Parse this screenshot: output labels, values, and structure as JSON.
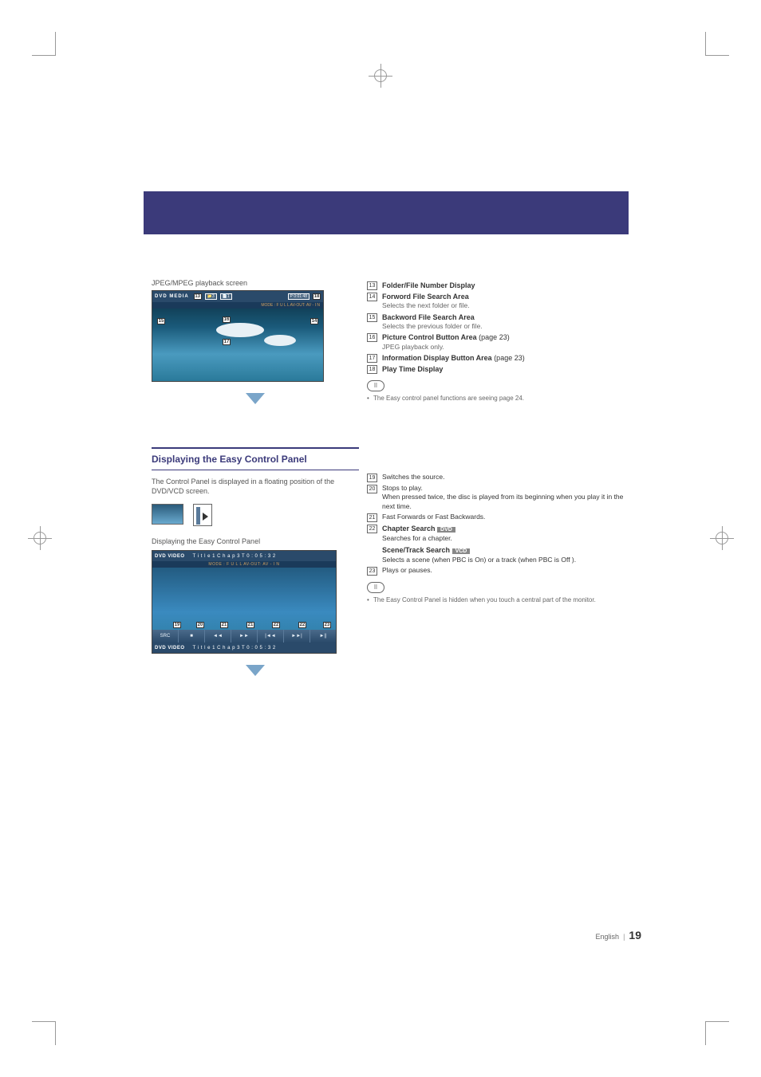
{
  "screen_label_top": "JPEG/MPEG playback screen",
  "shot1": {
    "title": "DVD MEDIA",
    "folder_num": "3",
    "file_num": "1",
    "playtime": "P   0:01:48",
    "sub": "MODE : F U L L     AV-OUT: AV - I N"
  },
  "callouts_right": [
    {
      "n": "13",
      "title": "Folder/File Number Display",
      "desc": ""
    },
    {
      "n": "14",
      "title": "Forword File Search Area",
      "desc": "Selects the next folder or file."
    },
    {
      "n": "15",
      "title": "Backword File Search Area",
      "desc": "Selects the previous folder or file."
    },
    {
      "n": "16",
      "title": "Picture Control Button Area",
      "tail": " (page 23)",
      "desc": "JPEG playback only."
    },
    {
      "n": "17",
      "title": "Information Display Button Area",
      "tail": " (page 23)",
      "desc": ""
    },
    {
      "n": "18",
      "title": "Play Time Display",
      "desc": ""
    }
  ],
  "note1": "The Easy control panel functions are seeing page 24.",
  "section_title": "Displaying the Easy Control Panel",
  "section_desc": "The Control Panel is displayed in a floating position of the DVD/VCD screen.",
  "screen_label_bottom": "Displaying the Easy Control Panel",
  "shot2": {
    "title": "DVD VIDEO",
    "info": "T i t l e   1       C h a p   3       T   0 : 0 5 : 3 2",
    "sub": "MODE : F U L L   AV-OUT: AV - I N",
    "btn_src": "SRC",
    "bot_title": "DVD VIDEO",
    "bot_info": "T i t l e   1       C h a p   3       T   0 : 0 5 : 3 2"
  },
  "callouts_right2": [
    {
      "n": "19",
      "desc": "Switches the source."
    },
    {
      "n": "20",
      "desc": "Stops to play.",
      "desc2": "When pressed twice, the disc is played from its beginning when you play it in the next time."
    },
    {
      "n": "21",
      "desc": "Fast Forwards or Fast Backwards."
    },
    {
      "n": "22",
      "title": "Chapter Search",
      "badge": "DVD",
      "desc": "Searches for a chapter.",
      "title2": "Scene/Track Search",
      "badge2": "VCD",
      "desc2": "Selects a scene (when PBC is On) or a track (when PBC is Off )."
    },
    {
      "n": "23",
      "desc": "Plays or pauses."
    }
  ],
  "note2": "The Easy Control Panel is hidden when you touch a central part of the monitor.",
  "footer_lang": "English",
  "footer_sep": "|",
  "footer_page": "19",
  "ctrl_callouts": [
    "19",
    "20",
    "21",
    "21",
    "22",
    "22",
    "23"
  ],
  "ctrl_icons": [
    "■",
    "◄◄",
    "►►",
    "|◄◄",
    "►►|",
    "►||"
  ]
}
